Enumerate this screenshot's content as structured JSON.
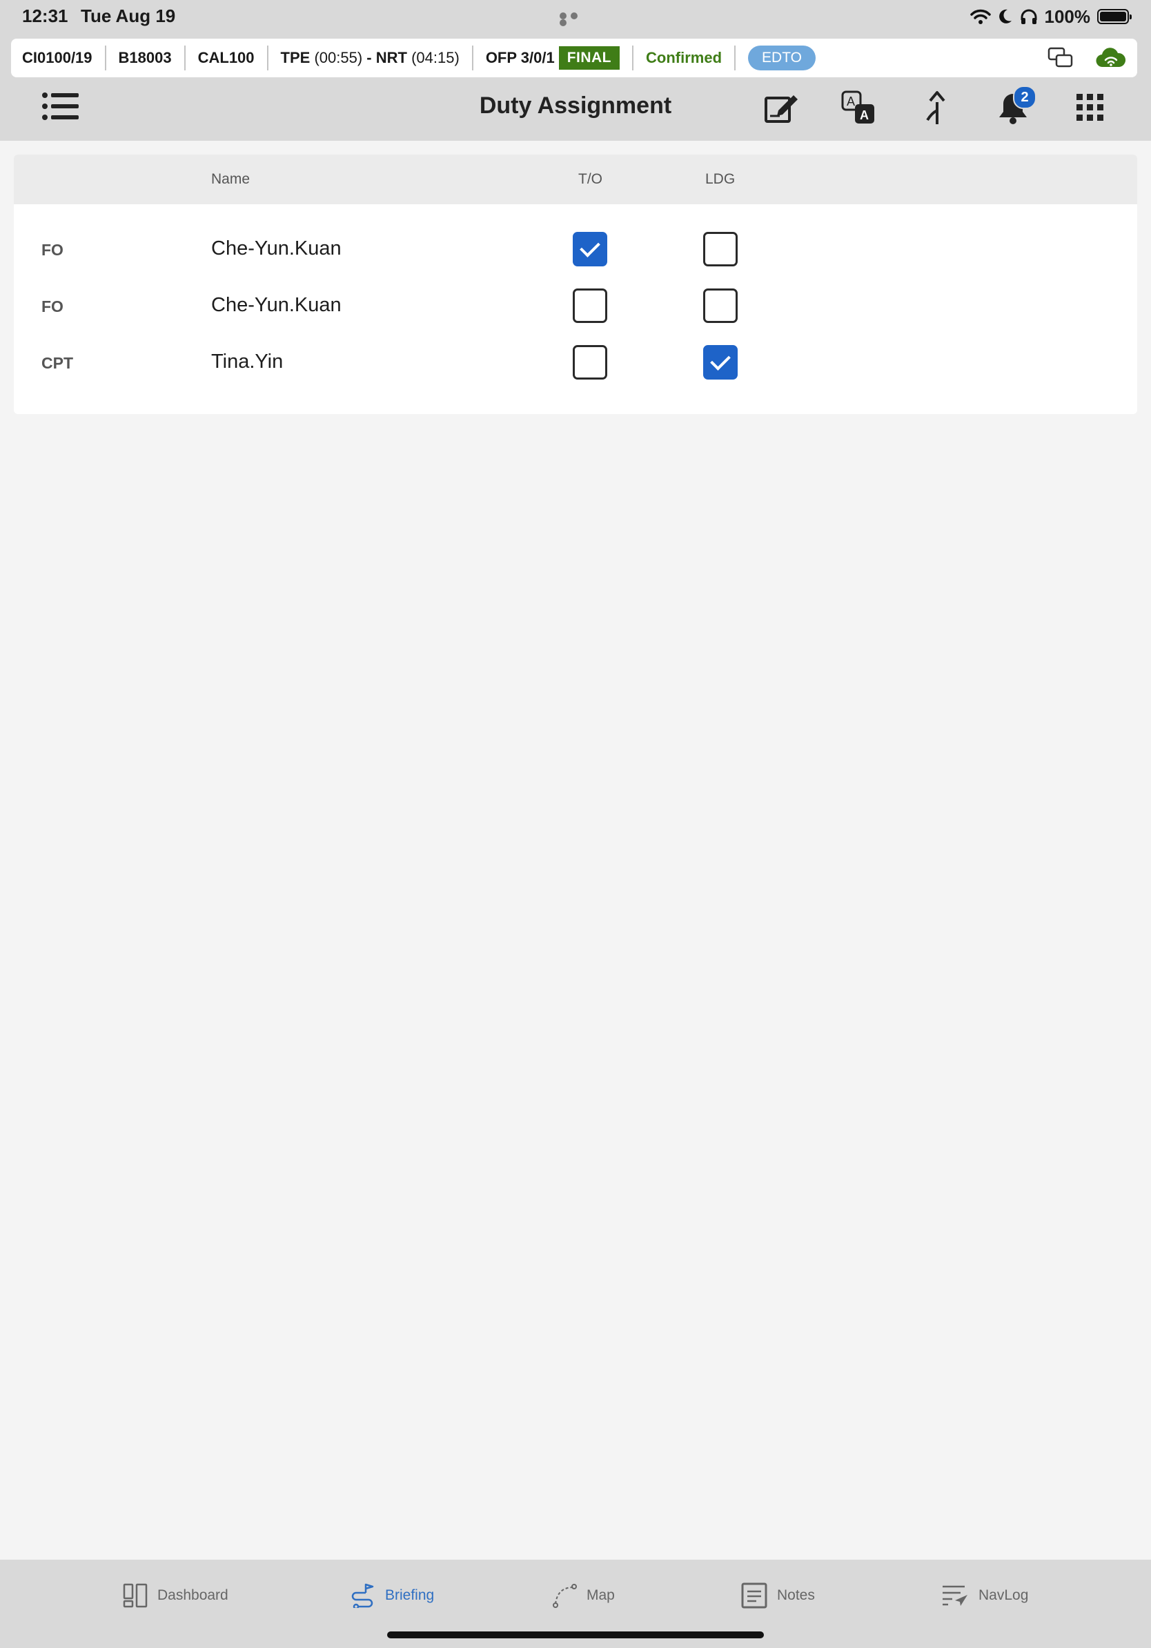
{
  "status_bar": {
    "time": "12:31",
    "date": "Tue Aug 19",
    "battery_pct": "100%",
    "icons": [
      "wifi-icon",
      "moon-icon",
      "headphones-icon",
      "battery-icon"
    ]
  },
  "flight_bar": {
    "flight": "CI0100/19",
    "aircraft": "B18003",
    "callsign": "CAL100",
    "dep": "TPE",
    "dep_time": "(00:55)",
    "sep": "-",
    "arr": "NRT",
    "arr_time": "(04:15)",
    "ofp": "OFP 3/0/1",
    "final_label": "FINAL",
    "confirmed_label": "Confirmed",
    "edto_label": "EDTO",
    "colors": {
      "final": "#3f7d17",
      "confirmed": "#3f7d17",
      "edto": "#6fa8dc",
      "cloud": "#3f7d17"
    }
  },
  "toolbar": {
    "title": "Duty Assignment",
    "notification_count": "2",
    "icons": [
      "list-menu-icon",
      "sign-edit-icon",
      "translate-icon",
      "route-branch-icon",
      "bell-icon",
      "grid-apps-icon"
    ]
  },
  "table": {
    "headers": {
      "role": "",
      "name": "Name",
      "takeoff": "T/O",
      "landing": "LDG"
    },
    "rows": [
      {
        "role": "FO",
        "name": "Che-Yun.Kuan",
        "takeoff": true,
        "landing": false
      },
      {
        "role": "FO",
        "name": "Che-Yun.Kuan",
        "takeoff": false,
        "landing": false
      },
      {
        "role": "CPT",
        "name": "Tina.Yin",
        "takeoff": false,
        "landing": true
      }
    ],
    "checked_color": "#1e63c8"
  },
  "tab_bar": {
    "tabs": [
      {
        "label": "Dashboard",
        "icon": "dashboard-icon",
        "active": false
      },
      {
        "label": "Briefing",
        "icon": "briefing-icon",
        "active": true
      },
      {
        "label": "Map",
        "icon": "map-route-icon",
        "active": false
      },
      {
        "label": "Notes",
        "icon": "notes-icon",
        "active": false
      },
      {
        "label": "NavLog",
        "icon": "navlog-icon",
        "active": false
      }
    ],
    "active_color": "#2f6fc2"
  }
}
